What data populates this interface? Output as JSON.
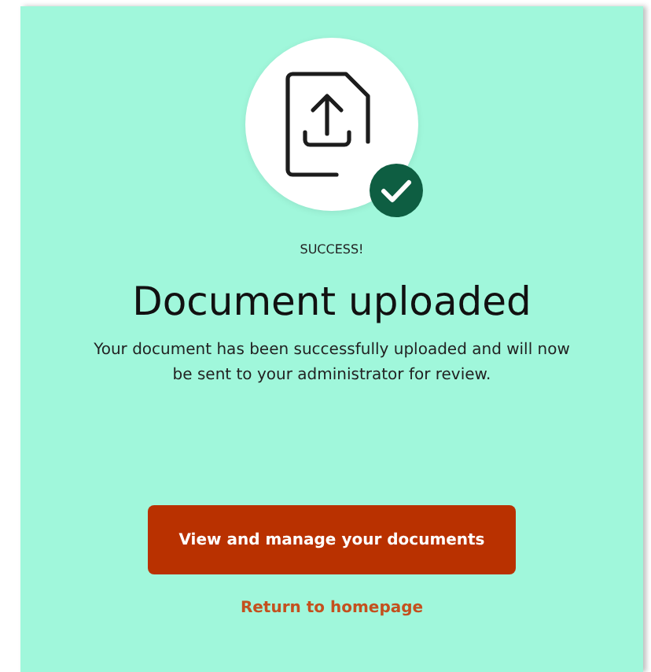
{
  "status_label": "SUCCESS!",
  "title": "Document uploaded",
  "message": "Your document has been successfully uploaded and will now be sent to your administrator for review.",
  "primary_button": "View and manage your documents",
  "link": "Return to homepage"
}
